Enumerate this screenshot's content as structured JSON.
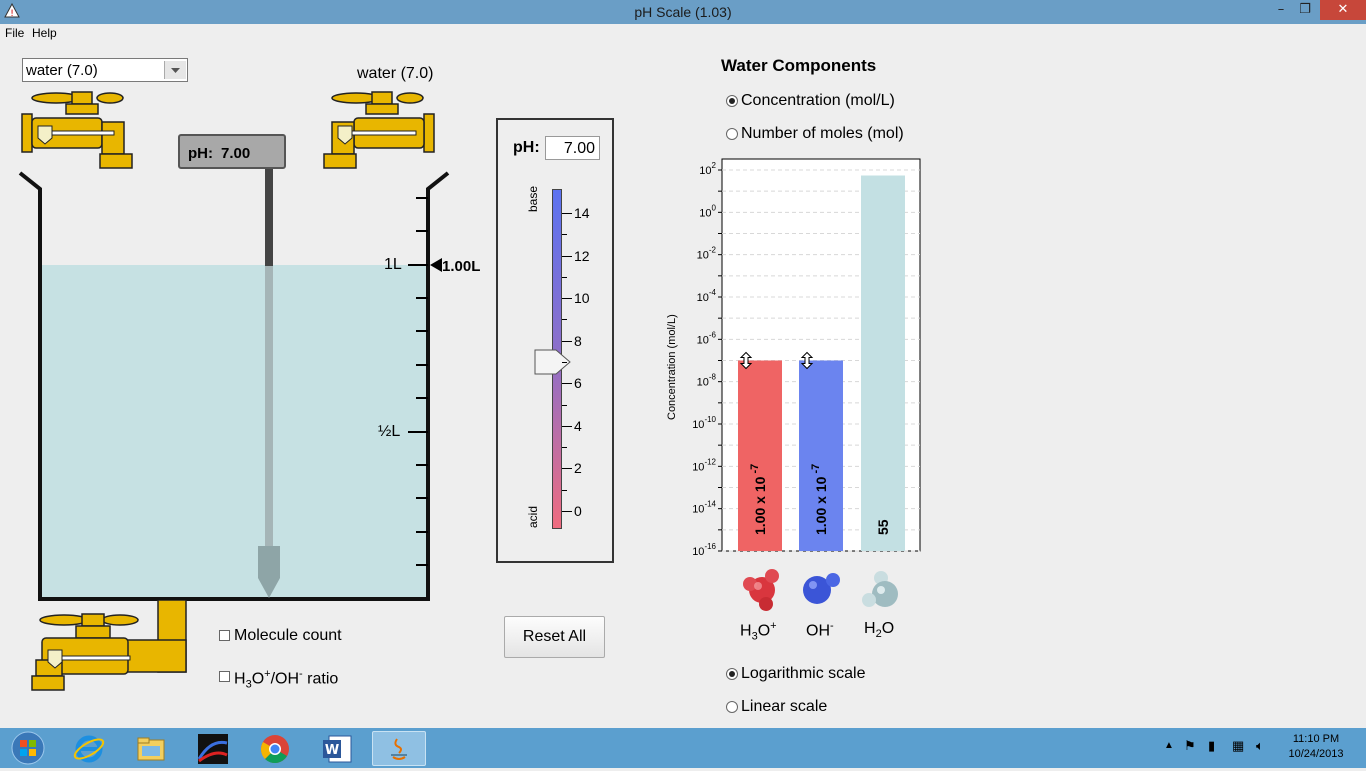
{
  "window": {
    "title": "pH Scale (1.03)",
    "controls": {
      "minimize": "–",
      "maximize": "❐",
      "close": "✕"
    }
  },
  "menu": {
    "file": "File",
    "help": "Help"
  },
  "solute_select": {
    "value": "water (7.0)",
    "options_visible": [
      "water (7.0)"
    ]
  },
  "faucet_label": "water (7.0)",
  "ph_meter": {
    "label": "pH:",
    "value": "7.00"
  },
  "beaker": {
    "volume_marker": "1.00L",
    "label_1l": "1L",
    "label_half": "½L"
  },
  "ph_slider": {
    "label": "pH:",
    "value": "7.00",
    "ticks": [
      "14",
      "12",
      "10",
      "8",
      "6",
      "4",
      "2",
      "0"
    ],
    "base_label": "base",
    "acid_label": "acid",
    "level": 7
  },
  "checkboxes": {
    "molecule_count": "Molecule count",
    "ratio_h": "H",
    "ratio_sub3": "3",
    "ratio_o": "O",
    "ratio_sup_plus": "+",
    "ratio_slash_oh": "/OH",
    "ratio_sup_minus": "-",
    "ratio_tail": " ratio"
  },
  "reset_button": "Reset All",
  "components": {
    "title": "Water Components",
    "radio_concentration": "Concentration (mol/L)",
    "radio_moles": "Number of moles (mol)",
    "scale_log": "Logarithmic scale",
    "scale_linear": "Linear scale",
    "colors": {
      "h3o": "#ef6464",
      "oh": "#6b84ef",
      "h2o": "#c3e0e3"
    }
  },
  "chart_data": {
    "type": "bar",
    "ylabel": "Concentration (mol/L)",
    "yscale": "log",
    "ylim_exponents": [
      -16,
      2
    ],
    "y_ticks": [
      {
        "base": "10",
        "exp": "2"
      },
      {
        "base": "10",
        "exp": "0"
      },
      {
        "base": "10",
        "exp": "-2"
      },
      {
        "base": "10",
        "exp": "-4"
      },
      {
        "base": "10",
        "exp": "-6"
      },
      {
        "base": "10",
        "exp": "-8"
      },
      {
        "base": "10",
        "exp": "-10"
      },
      {
        "base": "10",
        "exp": "-12"
      },
      {
        "base": "10",
        "exp": "-14"
      },
      {
        "base": "10",
        "exp": "-16"
      }
    ],
    "grid": true,
    "bars": [
      {
        "category": "H3O+",
        "value": 1e-07,
        "label_main": "1.00 x 10",
        "label_exp": "-7"
      },
      {
        "category": "OH-",
        "value": 1e-07,
        "label_main": "1.00 x 10",
        "label_exp": "-7"
      },
      {
        "category": "H2O",
        "value": 55,
        "label_main": "55",
        "label_exp": ""
      }
    ],
    "category_labels": [
      {
        "main": "H",
        "sub": "3",
        "main2": "O",
        "sup": "+"
      },
      {
        "main": "OH",
        "sub": "",
        "main2": "",
        "sup": "-"
      },
      {
        "main": "H",
        "sub": "2",
        "main2": "O",
        "sup": ""
      }
    ]
  },
  "taskbar": {
    "clock_time": "11:10 PM",
    "clock_date": "10/24/2013"
  }
}
